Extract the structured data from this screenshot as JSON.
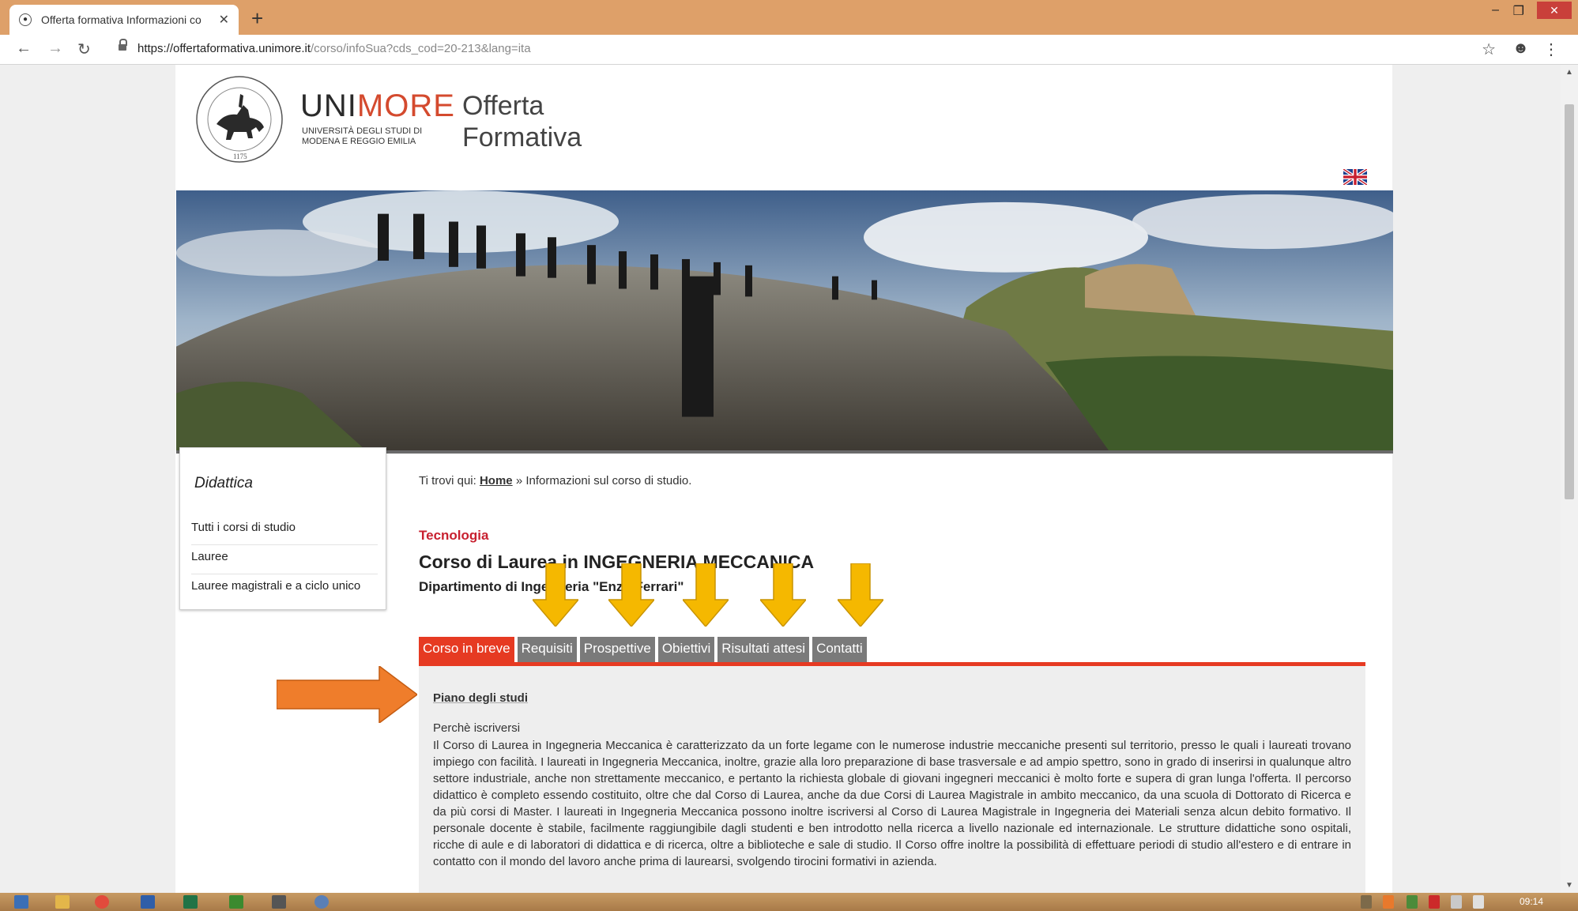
{
  "browser": {
    "tab_title": "Offerta formativa Informazioni co",
    "new_tab": "+",
    "url_host": "https://offertaformativa.unimore.it",
    "url_path": "/corso/infoSua?cds_cod=20-213&lang=ita",
    "clock": "09:14"
  },
  "header": {
    "brand_a": "UNI",
    "brand_b": "MORE",
    "brand_sub_1": "UNIVERSITÀ DEGLI STUDI DI",
    "brand_sub_2": "MODENA E REGGIO EMILIA",
    "offerta_1": "Offerta",
    "offerta_2": "Formativa",
    "seal_year": "1175"
  },
  "sidebar": {
    "title": "Didattica",
    "items": [
      {
        "label": "Tutti i corsi di studio"
      },
      {
        "label": "Lauree"
      },
      {
        "label": "Lauree magistrali e a ciclo unico"
      }
    ]
  },
  "breadcrumb": {
    "prefix": "Ti trovi qui:",
    "home": "Home",
    "current": "» Informazioni sul corso di studio."
  },
  "course": {
    "area": "Tecnologia",
    "title": "Corso di Laurea in INGEGNERIA MECCANICA",
    "department": "Dipartimento di Ingegneria \"Enzo Ferrari\""
  },
  "tabs": [
    {
      "label": "Corso in breve",
      "active": true
    },
    {
      "label": "Requisiti",
      "active": false
    },
    {
      "label": "Prospettive",
      "active": false
    },
    {
      "label": "Obiettivi",
      "active": false
    },
    {
      "label": "Risultati attesi",
      "active": false
    },
    {
      "label": "Contatti",
      "active": false
    }
  ],
  "panel": {
    "plan_link": "Piano degli studi",
    "why_heading": "Perchè iscriversi",
    "body": "Il Corso di Laurea in Ingegneria Meccanica è caratterizzato da un forte legame con le numerose industrie meccaniche presenti sul territorio, presso le quali i laureati trovano impiego con facilità. I laureati in Ingegneria Meccanica, inoltre, grazie alla loro preparazione di base trasversale e ad ampio spettro, sono in grado di inserirsi in qualunque altro settore industriale, anche non strettamente meccanico, e pertanto la richiesta globale di giovani ingegneri meccanici è molto forte e supera di gran lunga l'offerta. Il percorso didattico è completo essendo costituito, oltre che dal Corso di Laurea, anche da due Corsi di Laurea Magistrale in ambito meccanico, da una scuola di Dottorato di Ricerca e da più corsi di Master. I laureati in Ingegneria Meccanica possono inoltre iscriversi al Corso di Laurea Magistrale in Ingegneria dei Materiali senza alcun debito formativo. Il personale docente è stabile, facilmente raggiungibile dagli studenti e ben introdotto nella ricerca a livello nazionale ed internazionale. Le strutture didattiche sono ospitali, ricche di aule e di laboratori di didattica e di ricerca, oltre a biblioteche e sale di studio. Il Corso offre inoltre la possibilità di effettuare periodi di studio all'estero e di entrare in contatto con il mondo del lavoro anche prima di laurearsi, svolgendo tirocini formativi in azienda."
  },
  "colors": {
    "accent": "#e63a22",
    "tab_inactive": "#7a7a7a",
    "annotation_yellow": "#f5b800",
    "annotation_orange": "#ef7d2b"
  }
}
